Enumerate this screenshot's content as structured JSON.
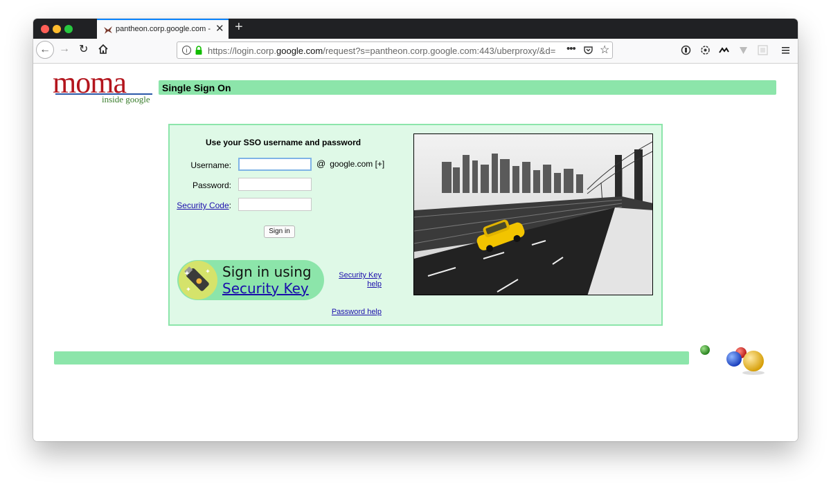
{
  "browser": {
    "tab_title": "pantheon.corp.google.com - MOMA Single Sign On",
    "tab_close": "✕",
    "new_tab": "+",
    "url_prefix": "https://login.corp.",
    "url_host": "google.com",
    "url_suffix": "/request?s=pantheon.corp.google.com:443/uberproxy/&d=",
    "url_more": "•••",
    "url_star": "☆",
    "nav_back": "←",
    "nav_forward": "→",
    "nav_reload": "↻"
  },
  "logo": {
    "title": "moma",
    "subtitle": "inside google"
  },
  "header": {
    "title": "Single Sign On"
  },
  "login": {
    "heading": "Use your SSO username and password",
    "username_label": "Username:",
    "password_label": "Password:",
    "security_code_link": "Security Code",
    "security_code_colon": ":",
    "at_sign": "@",
    "domain_suffix": "google.com [+]",
    "signin_button": "Sign in",
    "security_key_line1": "Sign in using",
    "security_key_line2": "Security Key",
    "security_key_help": "Security Key help",
    "password_help": "Password help"
  },
  "colors": {
    "accent_green": "#8ce5aa",
    "panel_bg": "#dff9e7",
    "link_blue": "#1a0dab",
    "logo_red": "#b3151d"
  }
}
